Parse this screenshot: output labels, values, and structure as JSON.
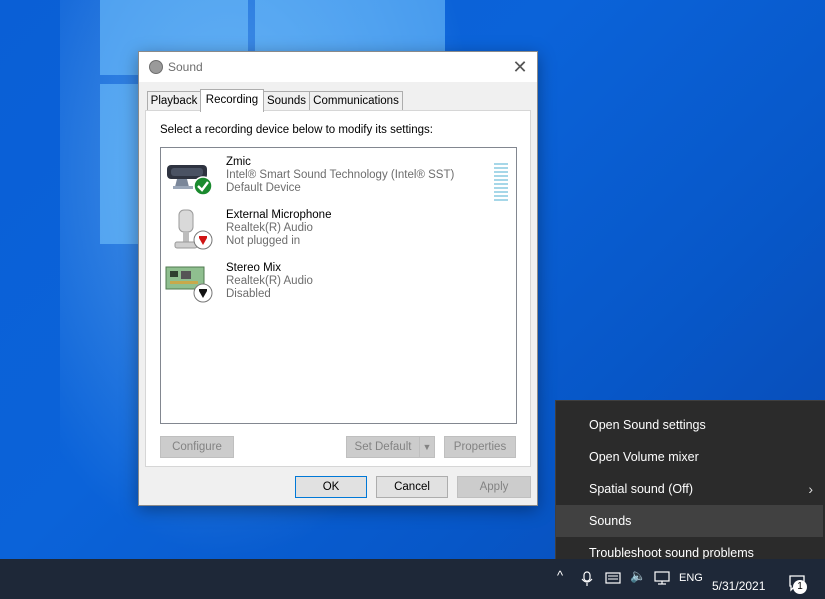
{
  "dialog": {
    "title": "Sound",
    "tabs": [
      {
        "label": "Playback"
      },
      {
        "label": "Recording",
        "active": true
      },
      {
        "label": "Sounds"
      },
      {
        "label": "Communications"
      }
    ],
    "instruction": "Select a recording device below to modify its settings:",
    "devices": [
      {
        "name": "Zmic",
        "subtitle": "Intel® Smart Sound Technology (Intel® SST)",
        "state": "Default Device",
        "icon": "microphone-bar-icon",
        "badge": "check-badge-icon"
      },
      {
        "name": "External Microphone",
        "subtitle": "Realtek(R) Audio",
        "state": "Not plugged in",
        "icon": "external-microphone-icon",
        "badge": "red-down-arrow-badge-icon"
      },
      {
        "name": "Stereo Mix",
        "subtitle": "Realtek(R) Audio",
        "state": "Disabled",
        "icon": "sound-card-icon",
        "badge": "black-down-arrow-badge-icon"
      }
    ],
    "buttons": {
      "configure": "Configure",
      "set_default": "Set Default",
      "properties": "Properties",
      "ok": "OK",
      "cancel": "Cancel",
      "apply": "Apply"
    }
  },
  "context_menu": {
    "items": [
      {
        "label": "Open Sound settings"
      },
      {
        "label": "Open Volume mixer"
      },
      {
        "label": "Spatial sound (Off)",
        "submenu": true
      },
      {
        "label": "Sounds",
        "highlighted": true
      },
      {
        "label": "Troubleshoot sound problems"
      }
    ]
  },
  "taskbar": {
    "language": "ENG",
    "date": "5/31/2021",
    "notification_count": "1"
  }
}
